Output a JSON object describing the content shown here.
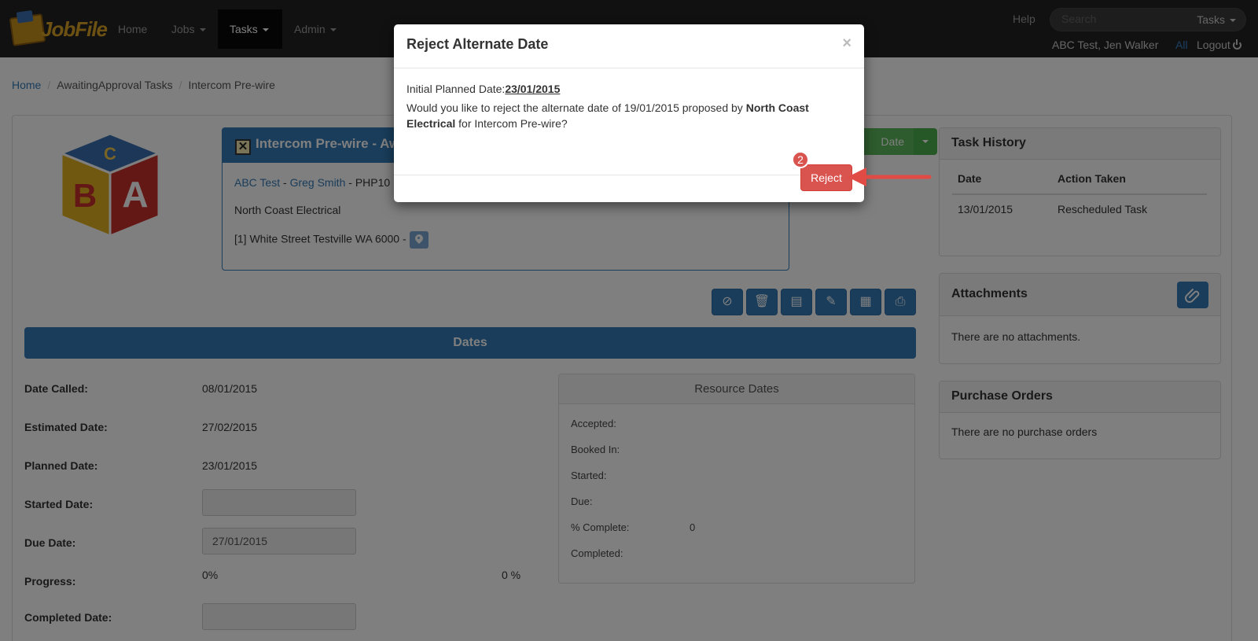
{
  "nav": {
    "logo_text": "JobFile",
    "items": [
      {
        "label": "Home",
        "has_caret": false
      },
      {
        "label": "Jobs",
        "has_caret": true
      },
      {
        "label": "Tasks",
        "has_caret": true,
        "active": true
      },
      {
        "label": "Admin",
        "has_caret": true
      }
    ],
    "help": "Help",
    "search_placeholder": "Search",
    "search_scope": "Tasks",
    "user": "ABC Test, Jen Walker",
    "all": "All",
    "logout": "Logout"
  },
  "breadcrumb": [
    "Home",
    "AwaitingApproval Tasks",
    "Intercom Pre-wire"
  ],
  "task": {
    "title": "Intercom Pre-wire - Awa",
    "client_link": "ABC Test",
    "contact_link": "Greg Smith",
    "code_suffix": " - PHP10",
    "company": "North Coast Electrical",
    "address": "[1] White Street Testville WA 6000 -",
    "green_button_label": "Date"
  },
  "dates": {
    "header": "Dates",
    "fields": [
      {
        "label": "Date Called:",
        "value": "08/01/2015"
      },
      {
        "label": "Estimated Date:",
        "value": "27/02/2015"
      },
      {
        "label": "Planned Date:",
        "value": "23/01/2015"
      },
      {
        "label": "Started Date:",
        "value": ""
      },
      {
        "label": "Due Date:",
        "value": "27/01/2015"
      },
      {
        "label": "Progress:",
        "value": "0%",
        "right_value": "0 %"
      },
      {
        "label": "Completed Date:",
        "value": ""
      }
    ]
  },
  "resource_dates": {
    "title": "Resource Dates",
    "rows": [
      {
        "label": "Accepted:",
        "value": ""
      },
      {
        "label": "Booked In:",
        "value": ""
      },
      {
        "label": "Started:",
        "value": ""
      },
      {
        "label": "Due:",
        "value": ""
      },
      {
        "label": "% Complete:",
        "value": "0"
      },
      {
        "label": "Completed:",
        "value": ""
      }
    ]
  },
  "task_history": {
    "title": "Task History",
    "columns": [
      "Date",
      "Action Taken"
    ],
    "rows": [
      [
        "13/01/2015",
        "Rescheduled Task"
      ]
    ]
  },
  "attachments": {
    "title": "Attachments",
    "empty_text": "There are no attachments."
  },
  "purchase_orders": {
    "title": "Purchase Orders",
    "empty_text": "There are no purchase orders"
  },
  "modal": {
    "title": "Reject Alternate Date",
    "close": "×",
    "initial_label": "Initial Planned Date:",
    "initial_date": "23/01/2015",
    "message_before": "Would you like to reject the alternate date of 19/01/2015 proposed by ",
    "message_company": "North Coast Electrical",
    "message_after": " for Intercom Pre-wire?",
    "reject_label": "Reject",
    "step_badge": "2"
  },
  "colors": {
    "navbar": "#222222",
    "primary": "#337ab7",
    "danger": "#d9534f",
    "success": "#5cb85c"
  }
}
